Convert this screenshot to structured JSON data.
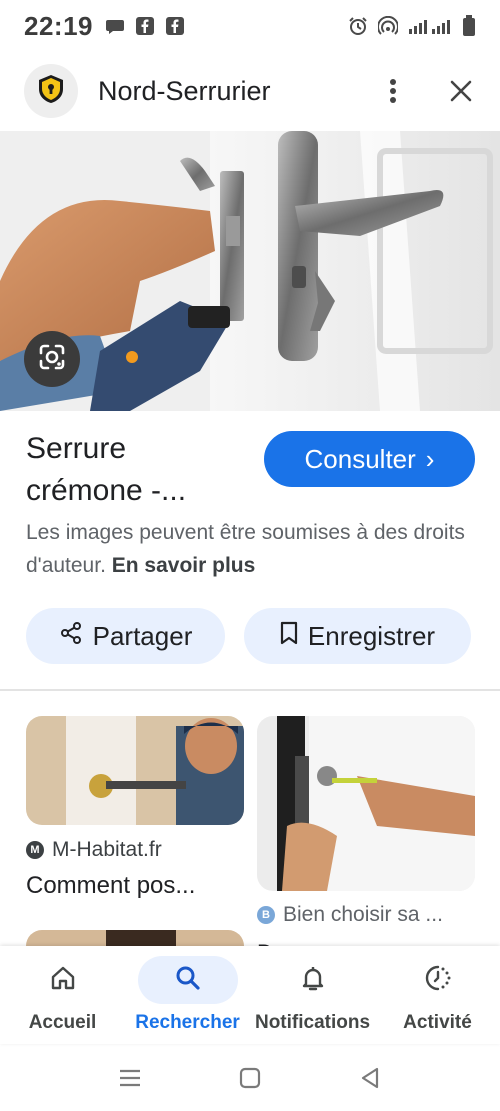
{
  "status_bar": {
    "time": "22:19",
    "left_icons": [
      "message-icon",
      "facebook-icon",
      "facebook-icon"
    ],
    "right_icons": [
      "alarm-icon",
      "hotspot-icon",
      "signal-icon",
      "battery-icon"
    ]
  },
  "header": {
    "site_name": "Nord-Serrurier",
    "logo_icon": "shield-lock-icon",
    "menu_icon": "more-vert-icon",
    "close_icon": "close-icon"
  },
  "hero": {
    "alt": "door-lock-install-photo",
    "lens_icon": "google-lens-icon"
  },
  "result": {
    "title_line1": "Serrure",
    "title_line2": "crémone -...",
    "consult_label": "Consulter",
    "consult_chevron": "›",
    "copyright_text": "Les images peuvent être soumises à des droits d'auteur.",
    "learn_more": "En savoir plus"
  },
  "actions": {
    "share_label": "Partager",
    "save_label": "Enregistrer"
  },
  "related": [
    {
      "source": "M-Habitat.fr",
      "source_letter": "M",
      "caption": "Comment pos..."
    },
    {
      "source": "Bien choisir sa ...",
      "source_letter": "B",
      "caption": "D..."
    }
  ],
  "bottom_nav": {
    "items": [
      {
        "label": "Accueil",
        "icon": "home-icon"
      },
      {
        "label": "Rechercher",
        "icon": "search-icon"
      },
      {
        "label": "Notifications",
        "icon": "bell-icon"
      },
      {
        "label": "Activité",
        "icon": "activity-icon"
      }
    ],
    "active_index": 1
  },
  "system_nav": {
    "icons": [
      "recents-icon",
      "home-square-icon",
      "back-icon"
    ]
  },
  "colors": {
    "accent": "#1a73e8",
    "chip_bg": "#e8f0fe",
    "text_primary": "#202124",
    "text_secondary": "#5f6368"
  }
}
